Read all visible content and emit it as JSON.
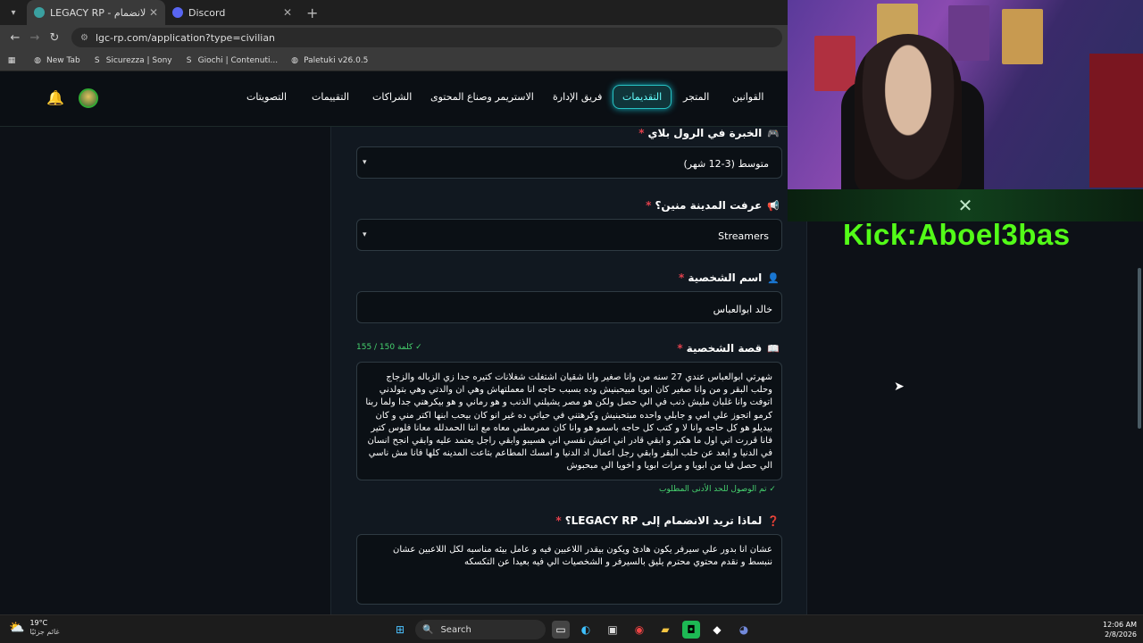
{
  "browser": {
    "tabs": [
      {
        "title": "LEGACY RP - تقديم طلب الانضمام",
        "active": true
      },
      {
        "title": "Discord",
        "active": false
      }
    ],
    "url": "lgc-rp.com/application?type=civilian",
    "bookmarks": [
      "New Tab",
      "Sicurezza | Sony",
      "Giochi | Contenuti...",
      "Paletuki v26.0.5"
    ]
  },
  "nav": {
    "items": [
      "القوانين",
      "المتجر",
      "التقديمات",
      "فريق الإدارة",
      "الاستريمر وصناع المحتوى",
      "الشراكات",
      "التقييمات",
      "التصويتات"
    ],
    "active": "التقديمات"
  },
  "form": {
    "experience": {
      "label": "الخبرة في الرول بلاي",
      "value": "متوسط (3-12 شهر)"
    },
    "source": {
      "label": "عرفت المدينة منين؟",
      "value": "Streamers"
    },
    "character_name": {
      "label": "اسم الشخصية",
      "value": "خالد ابوالعباس"
    },
    "story": {
      "label": "قصة الشخصية",
      "word_count": "155 / 150 كلمة ✓",
      "text": "شهرتي ابوالعباس  عندي 27 سنه من وانا صغير وانا شقيان اشتغلت شغلانات كتيره جدا زي الزباله والزجاج وحلب البقر و من وانا صغير كان ابويا مبيحبنيش وده بسبب حاجه انا معملتهاش وهي ان والدتي وهي بتولدني اتوفت وانا غلبان مليش ذنب في الي حصل ولكن هو مصر يشيلني الذنب و هو رماني و هو بيكرهني جدا  ولما ربنا كرمو اتجوز علي امي و جابلي واحده مبتحبنيش وكرهتني في حياتي ده غير انو كان بيحب ابنها  اكتر مني و كان بيديلو هو كل حاجه وانا لا و كتب كل حاجه باسمو هو وانا كان ممرمطني معاه مع اننا الحمدلله معانا فلوس كتير فانا قررت اني اول ما هكبر و ابقي قادر اني اعيش نفسي اني هسيبو وابقي راجل يعتمد عليه وابقي انجح  انسان في الدنيا و ابعد عن  حلب البقر وابقي رجل اعمال اد الدنيا و امسك المطاعم بتاعت المدينه كلها فانا مش ناسي الي حصل فيا من ابويا و مرات ابويا و اخويا الي مبحبوش",
      "min_reached": "✓ تم الوصول للحد الأدنى المطلوب"
    },
    "why_join": {
      "label": "لماذا تريد الانضمام إلى LEGACY RP؟",
      "text": "عشان انا بدور علي سيرفر يكون هادئ ويكون بيقدر اللاعبين فيه و عامل بيئه مناسبه  لكل اللاعبين  عشان ننبسط و نقدم محتوي محترم يليق بالسيرفر  و الشخصيات الي فيه  بعيدا عن التكسكه"
    }
  },
  "stream": {
    "kick": "Kick:Aboel3bas"
  },
  "taskbar": {
    "temp": "19°C",
    "condition": "غائم جزئيًا",
    "search": "Search",
    "time": "12:06 AM",
    "date": "2/8/2026"
  }
}
